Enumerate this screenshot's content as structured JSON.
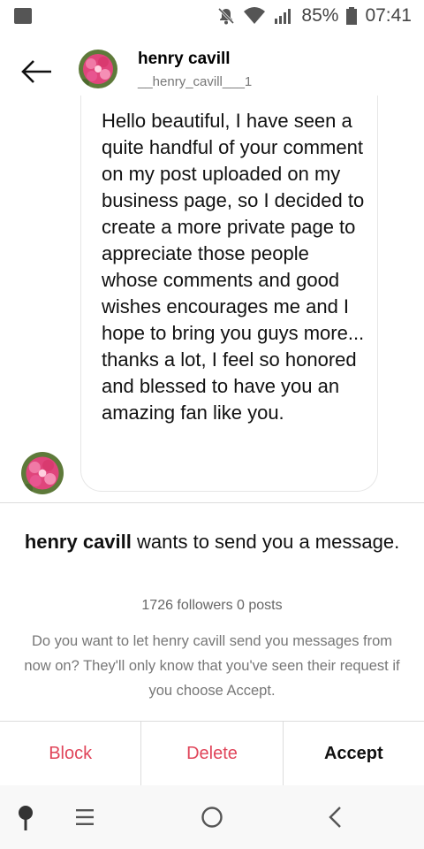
{
  "status_bar": {
    "battery": "85%",
    "time": "07:41",
    "icons": [
      "image-icon",
      "mute-icon",
      "wifi-icon",
      "signal-icon",
      "battery-icon"
    ]
  },
  "header": {
    "name": "henry cavill",
    "username": "__henry_cavill___1",
    "back_icon": "back-arrow-icon"
  },
  "message": {
    "text": "Hello beautiful, I have seen a quite handful of your comment on my post uploaded on my business page, so I decided to create a more private page to appreciate those people whose comments and good wishes encourages me and I hope to bring you guys more... thanks a lot, I feel so honored and blessed to have you an amazing fan like you."
  },
  "request": {
    "sender": "henry cavill",
    "title_rest": " wants to send you a message.",
    "stats": "1726 followers 0 posts",
    "description": "Do you want to let henry cavill send you messages from now on? They'll only know that you've seen their request if you choose Accept."
  },
  "actions": {
    "block": "Block",
    "delete": "Delete",
    "accept": "Accept"
  },
  "colors": {
    "destructive": "#e0455a",
    "secondary_text": "#777777"
  },
  "nav_icons": [
    "pin-icon",
    "menu-icon",
    "home-icon",
    "back-icon"
  ]
}
